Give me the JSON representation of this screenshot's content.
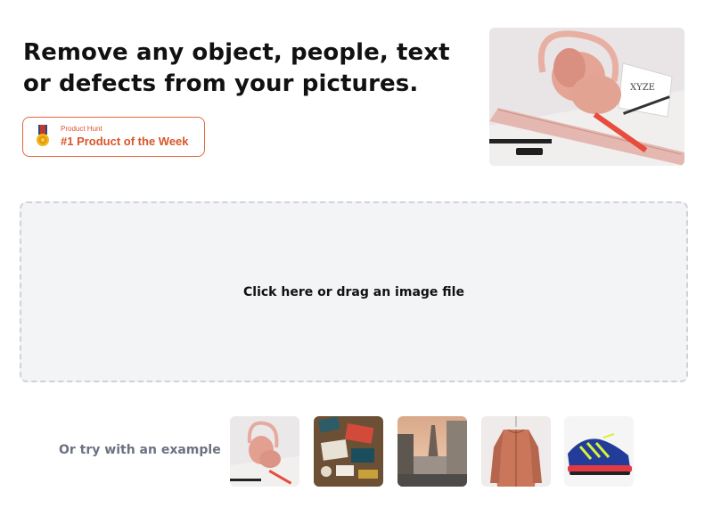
{
  "headline": {
    "line1": "Remove any object, people, text",
    "line2": "or defects from your pictures."
  },
  "badge": {
    "small": "Product Hunt",
    "big": "#1 Product of the Week",
    "icon": "medal-icon",
    "color": "#d9552a"
  },
  "hero": {
    "alt": "pink bag on drawing table"
  },
  "dropzone": {
    "label": "Click here or drag an image file"
  },
  "examples": {
    "label": "Or try with an example",
    "items": [
      {
        "alt": "pink bag"
      },
      {
        "alt": "desk items"
      },
      {
        "alt": "paris street"
      },
      {
        "alt": "orange jacket"
      },
      {
        "alt": "blue sneaker"
      }
    ]
  }
}
